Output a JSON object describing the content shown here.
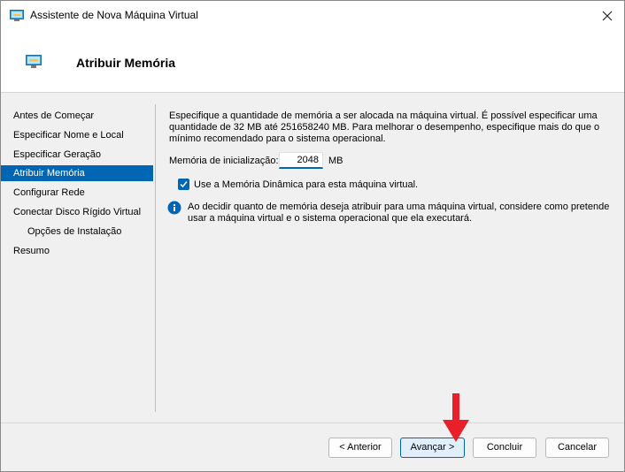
{
  "window": {
    "title": "Assistente de Nova Máquina Virtual"
  },
  "header": {
    "title": "Atribuir Memória"
  },
  "nav": {
    "items": [
      {
        "label": "Antes de Começar",
        "selected": false,
        "sub": false
      },
      {
        "label": "Especificar Nome e Local",
        "selected": false,
        "sub": false
      },
      {
        "label": "Especificar Geração",
        "selected": false,
        "sub": false
      },
      {
        "label": "Atribuir Memória",
        "selected": true,
        "sub": false
      },
      {
        "label": "Configurar Rede",
        "selected": false,
        "sub": false
      },
      {
        "label": "Conectar Disco Rígido Virtual",
        "selected": false,
        "sub": false
      },
      {
        "label": "Opções de Instalação",
        "selected": false,
        "sub": true
      },
      {
        "label": "Resumo",
        "selected": false,
        "sub": false
      }
    ]
  },
  "content": {
    "description": "Especifique a quantidade de memória a ser alocada na máquina virtual. É possível especificar uma quantidade de 32 MB até 251658240 MB. Para melhorar o desempenho, especifique mais do que o mínimo recomendado para o sistema operacional.",
    "startup_memory_label": "Memória de inicialização:",
    "startup_memory_value": "2048",
    "startup_memory_unit": "MB",
    "dynamic_memory_label": "Use a Memória Dinâmica para esta máquina virtual.",
    "dynamic_memory_checked": true,
    "info_text": "Ao decidir quanto de memória deseja atribuir para uma máquina virtual, considere como pretende usar a máquina virtual e o sistema operacional que ela executará."
  },
  "buttons": {
    "previous": "< Anterior",
    "next": "Avançar >",
    "finish": "Concluir",
    "cancel": "Cancelar"
  },
  "icons": {
    "window": "vm-monitor-icon",
    "header": "vm-monitor-icon",
    "close": "close-icon",
    "info": "info-icon",
    "annotation": "red-down-arrow"
  },
  "colors": {
    "accent": "#0066b4",
    "annotation_arrow": "#e8202a"
  }
}
